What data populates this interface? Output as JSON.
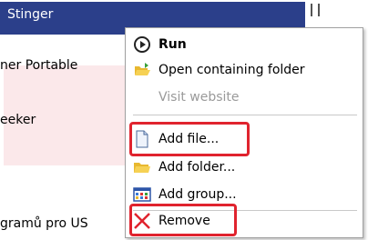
{
  "background_list": {
    "selected_item": "Stinger",
    "items": [
      "ner Portable",
      "eeker",
      "gramů pro US"
    ]
  },
  "context_menu": {
    "items": [
      {
        "label": "Run",
        "icon": "run-icon",
        "bold": true
      },
      {
        "label": "Open containing folder",
        "icon": "folder-open-icon"
      },
      {
        "label": "Visit website",
        "icon": "",
        "disabled": true
      },
      {
        "label": "Add file...",
        "icon": "file-icon"
      },
      {
        "label": "Add folder...",
        "icon": "folder-icon"
      },
      {
        "label": "Add group...",
        "icon": "group-icon"
      },
      {
        "label": "Remove",
        "icon": "remove-icon"
      }
    ]
  },
  "colors": {
    "highlight_box": "#e0232e",
    "selection": "#2b3f8a"
  }
}
